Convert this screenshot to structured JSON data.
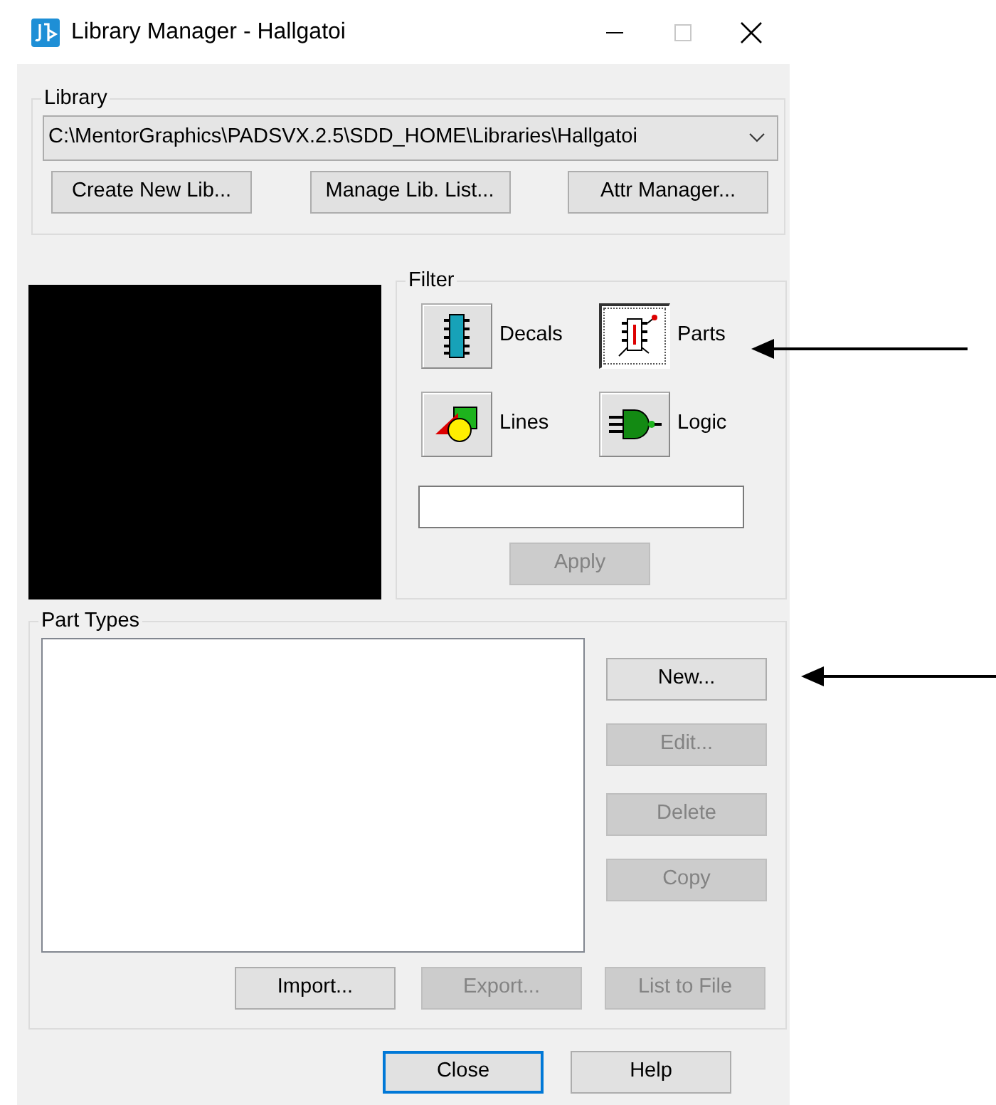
{
  "window": {
    "title": "Library Manager - Hallgatoi",
    "maximize_disabled": true
  },
  "library": {
    "label": "Library",
    "path": "C:\\MentorGraphics\\PADSVX.2.5\\SDD_HOME\\Libraries\\Hallgatoi",
    "buttons": [
      {
        "label": "Create New Lib...",
        "disabled": false
      },
      {
        "label": "Manage Lib. List...",
        "disabled": false
      },
      {
        "label": "Attr Manager...",
        "disabled": false
      }
    ]
  },
  "filter": {
    "label": "Filter",
    "options": [
      {
        "kind": "decals",
        "label": "Decals",
        "selected": false
      },
      {
        "kind": "parts",
        "label": "Parts",
        "selected": true
      },
      {
        "kind": "lines",
        "label": "Lines",
        "selected": false
      },
      {
        "kind": "logic",
        "label": "Logic",
        "selected": false
      }
    ],
    "apply": {
      "label": "Apply",
      "disabled": true
    }
  },
  "part_types": {
    "label": "Part Types",
    "side_buttons": [
      {
        "label": "New...",
        "disabled": false
      },
      {
        "label": "Edit...",
        "disabled": true
      },
      {
        "label": "Delete",
        "disabled": true
      },
      {
        "label": "Copy",
        "disabled": true
      }
    ],
    "bottom_buttons": [
      {
        "label": "Import...",
        "disabled": false
      },
      {
        "label": "Export...",
        "disabled": true
      },
      {
        "label": "List to File",
        "disabled": true
      }
    ]
  },
  "dialog_buttons": [
    {
      "label": "Close",
      "default": true
    },
    {
      "label": "Help",
      "default": false
    }
  ]
}
